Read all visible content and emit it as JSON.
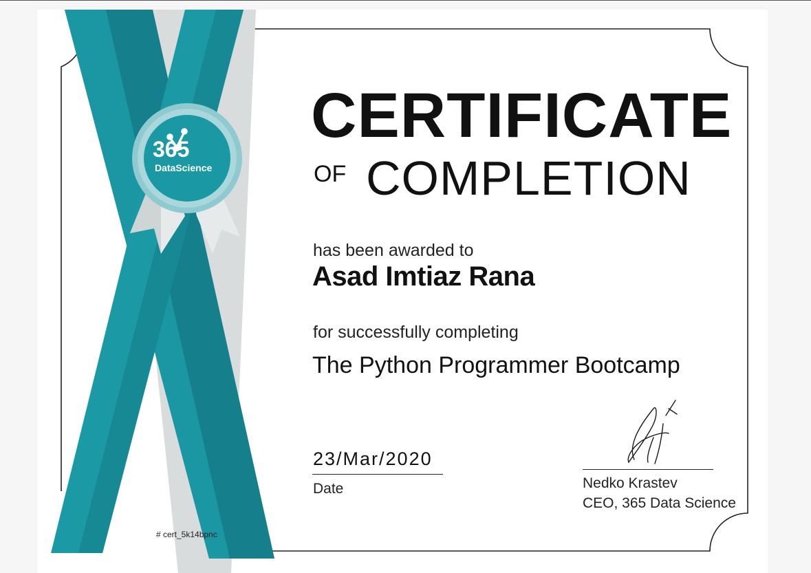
{
  "certificate": {
    "title_main": "CERTIFICATE",
    "title_of": "OF",
    "title_sub": "COMPLETION",
    "awarded_text": "has been awarded to",
    "recipient": "Asad Imtiaz Rana",
    "completing_text": "for successfully completing",
    "course": "The Python Programmer Bootcamp",
    "date": "23/Mar/2020",
    "date_label": "Date",
    "signer_name": "Nedko Krastev",
    "signer_role": "CEO, 365 Data Science",
    "cert_id": "# cert_5k14bpnc"
  },
  "brand": {
    "logo_number": "365",
    "logo_name": "DataScience"
  },
  "colors": {
    "teal_dark": "#167e8a",
    "teal": "#1a9aa6",
    "teal_light": "#7fc5cb",
    "text": "#111111"
  }
}
